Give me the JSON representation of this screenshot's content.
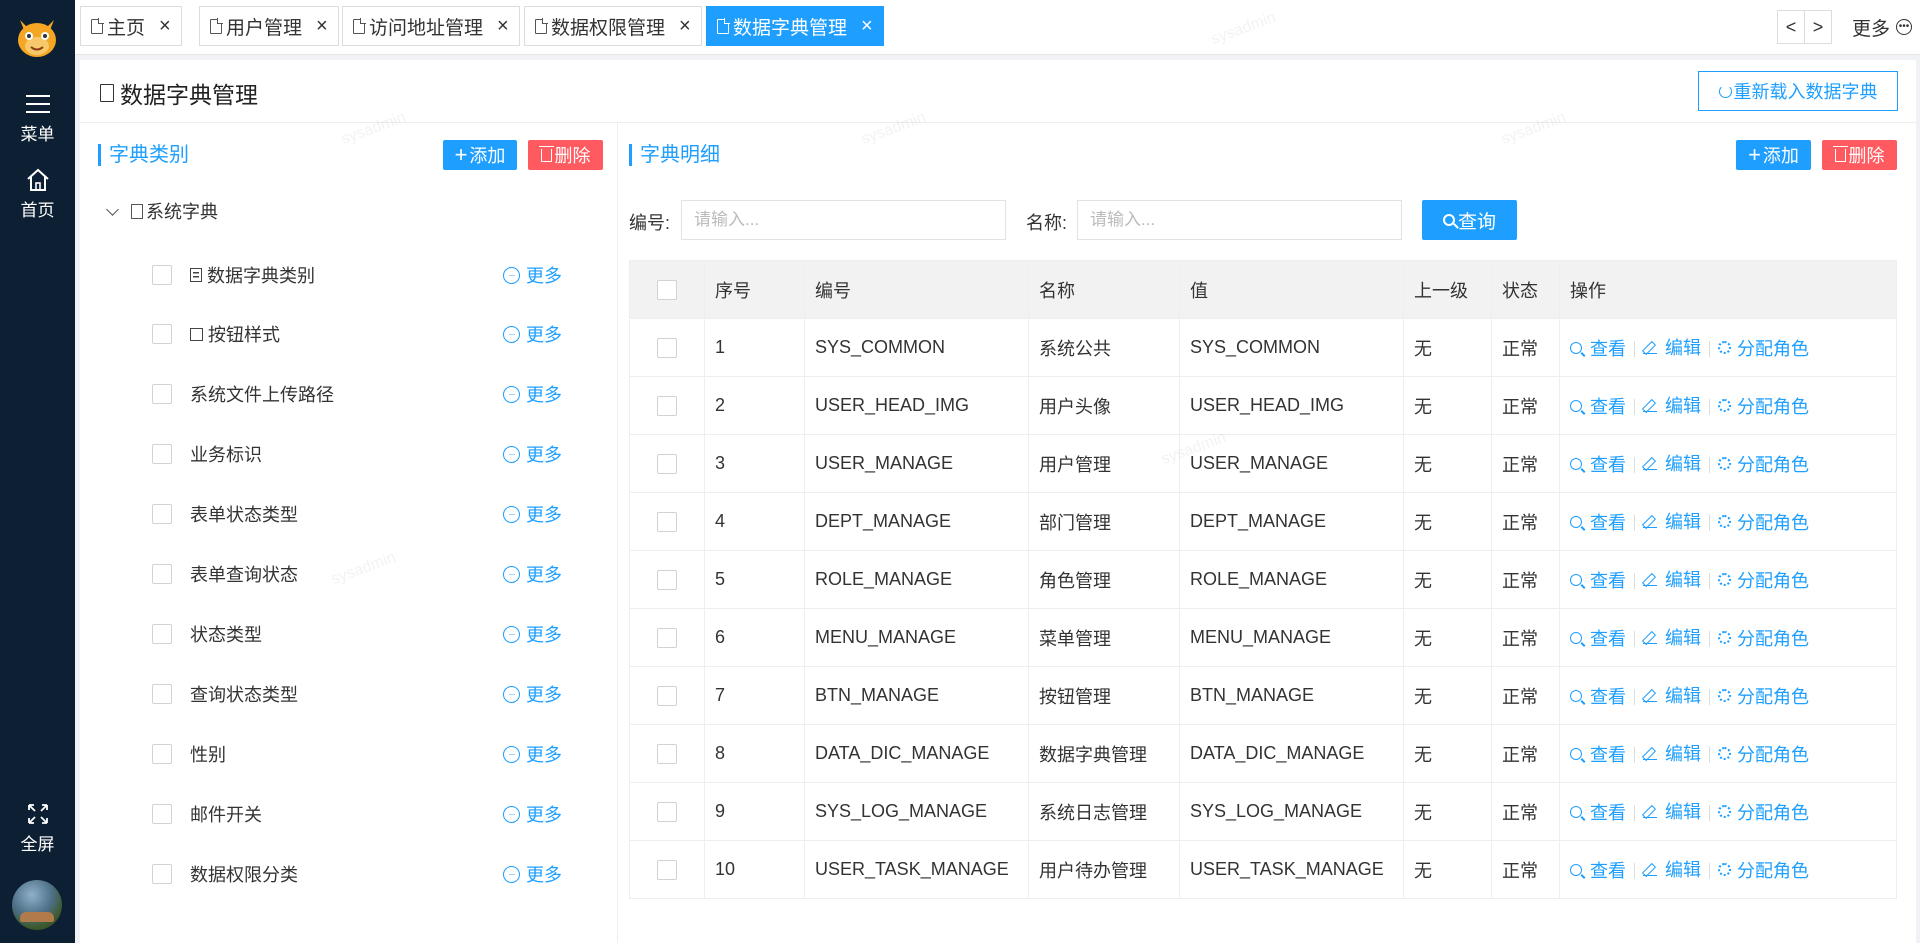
{
  "sidebar": {
    "menu_label": "菜单",
    "home_label": "首页",
    "fullscreen_label": "全屏"
  },
  "tabs": [
    {
      "label": "主页"
    },
    {
      "label": "用户管理"
    },
    {
      "label": "访问地址管理"
    },
    {
      "label": "数据权限管理"
    },
    {
      "label": "数据字典管理",
      "active": true
    }
  ],
  "topbar": {
    "prev": "<",
    "next": ">",
    "more_label": "更多"
  },
  "page": {
    "title": "数据字典管理",
    "reload_label": "重新载入数据字典"
  },
  "left_panel": {
    "title": "字典类别",
    "add_label": "添加",
    "delete_label": "删除",
    "tree_root": "系统字典",
    "more_label": "更多",
    "items": [
      {
        "label": "数据字典类别",
        "icon": "list-icon"
      },
      {
        "label": "按钮样式",
        "icon": "square-icon"
      },
      {
        "label": "系统文件上传路径"
      },
      {
        "label": "业务标识"
      },
      {
        "label": "表单状态类型"
      },
      {
        "label": "表单查询状态"
      },
      {
        "label": "状态类型"
      },
      {
        "label": "查询状态类型"
      },
      {
        "label": "性别"
      },
      {
        "label": "邮件开关"
      },
      {
        "label": "数据权限分类"
      }
    ]
  },
  "right_panel": {
    "title": "字典明细",
    "add_label": "添加",
    "delete_label": "删除",
    "search": {
      "code_label": "编号:",
      "code_placeholder": "请输入...",
      "name_label": "名称:",
      "name_placeholder": "请输入...",
      "query_label": "查询"
    },
    "table": {
      "headers": [
        "序号",
        "编号",
        "名称",
        "值",
        "上一级",
        "状态",
        "操作"
      ],
      "actions": {
        "view": "查看",
        "edit": "编辑",
        "assign": "分配角色"
      },
      "rows": [
        {
          "no": "1",
          "code": "SYS_COMMON",
          "name": "系统公共",
          "value": "SYS_COMMON",
          "parent": "无",
          "status": "正常"
        },
        {
          "no": "2",
          "code": "USER_HEAD_IMG",
          "name": "用户头像",
          "value": "USER_HEAD_IMG",
          "parent": "无",
          "status": "正常"
        },
        {
          "no": "3",
          "code": "USER_MANAGE",
          "name": "用户管理",
          "value": "USER_MANAGE",
          "parent": "无",
          "status": "正常"
        },
        {
          "no": "4",
          "code": "DEPT_MANAGE",
          "name": "部门管理",
          "value": "DEPT_MANAGE",
          "parent": "无",
          "status": "正常"
        },
        {
          "no": "5",
          "code": "ROLE_MANAGE",
          "name": "角色管理",
          "value": "ROLE_MANAGE",
          "parent": "无",
          "status": "正常"
        },
        {
          "no": "6",
          "code": "MENU_MANAGE",
          "name": "菜单管理",
          "value": "MENU_MANAGE",
          "parent": "无",
          "status": "正常"
        },
        {
          "no": "7",
          "code": "BTN_MANAGE",
          "name": "按钮管理",
          "value": "BTN_MANAGE",
          "parent": "无",
          "status": "正常"
        },
        {
          "no": "8",
          "code": "DATA_DIC_MANAGE",
          "name": "数据字典管理",
          "value": "DATA_DIC_MANAGE",
          "parent": "无",
          "status": "正常"
        },
        {
          "no": "9",
          "code": "SYS_LOG_MANAGE",
          "name": "系统日志管理",
          "value": "SYS_LOG_MANAGE",
          "parent": "无",
          "status": "正常"
        },
        {
          "no": "10",
          "code": "USER_TASK_MANAGE",
          "name": "用户待办管理",
          "value": "USER_TASK_MANAGE",
          "parent": "无",
          "status": "正常"
        }
      ]
    }
  },
  "watermark": "sysadmin",
  "colors": {
    "accent": "#1e9fff",
    "danger": "#ff5a5f",
    "sidebar": "#0c1f33"
  }
}
